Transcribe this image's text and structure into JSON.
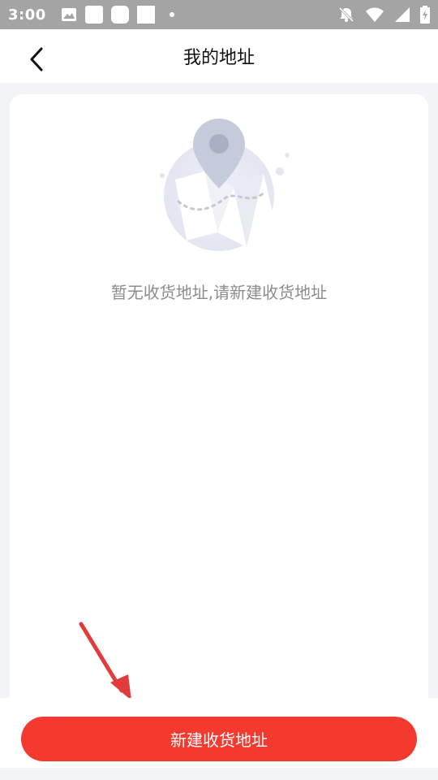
{
  "status_bar": {
    "time": "3:00",
    "icons": [
      "image-icon",
      "notification-square-icon",
      "notification-rounded-icon",
      "notification-square-icon",
      "dot-icon",
      "alarm-off-icon",
      "wifi-icon",
      "signal-icon",
      "battery-charging-icon"
    ]
  },
  "header": {
    "title": "我的地址",
    "back_icon": "chevron-left-icon"
  },
  "empty_state": {
    "illustration": "map-pin-illustration",
    "message": "暂无收货地址,请新建收货地址"
  },
  "footer": {
    "button_label": "新建收货地址",
    "button_color": "#f43a2e"
  },
  "annotation": {
    "arrow_color": "#e23b3b"
  }
}
